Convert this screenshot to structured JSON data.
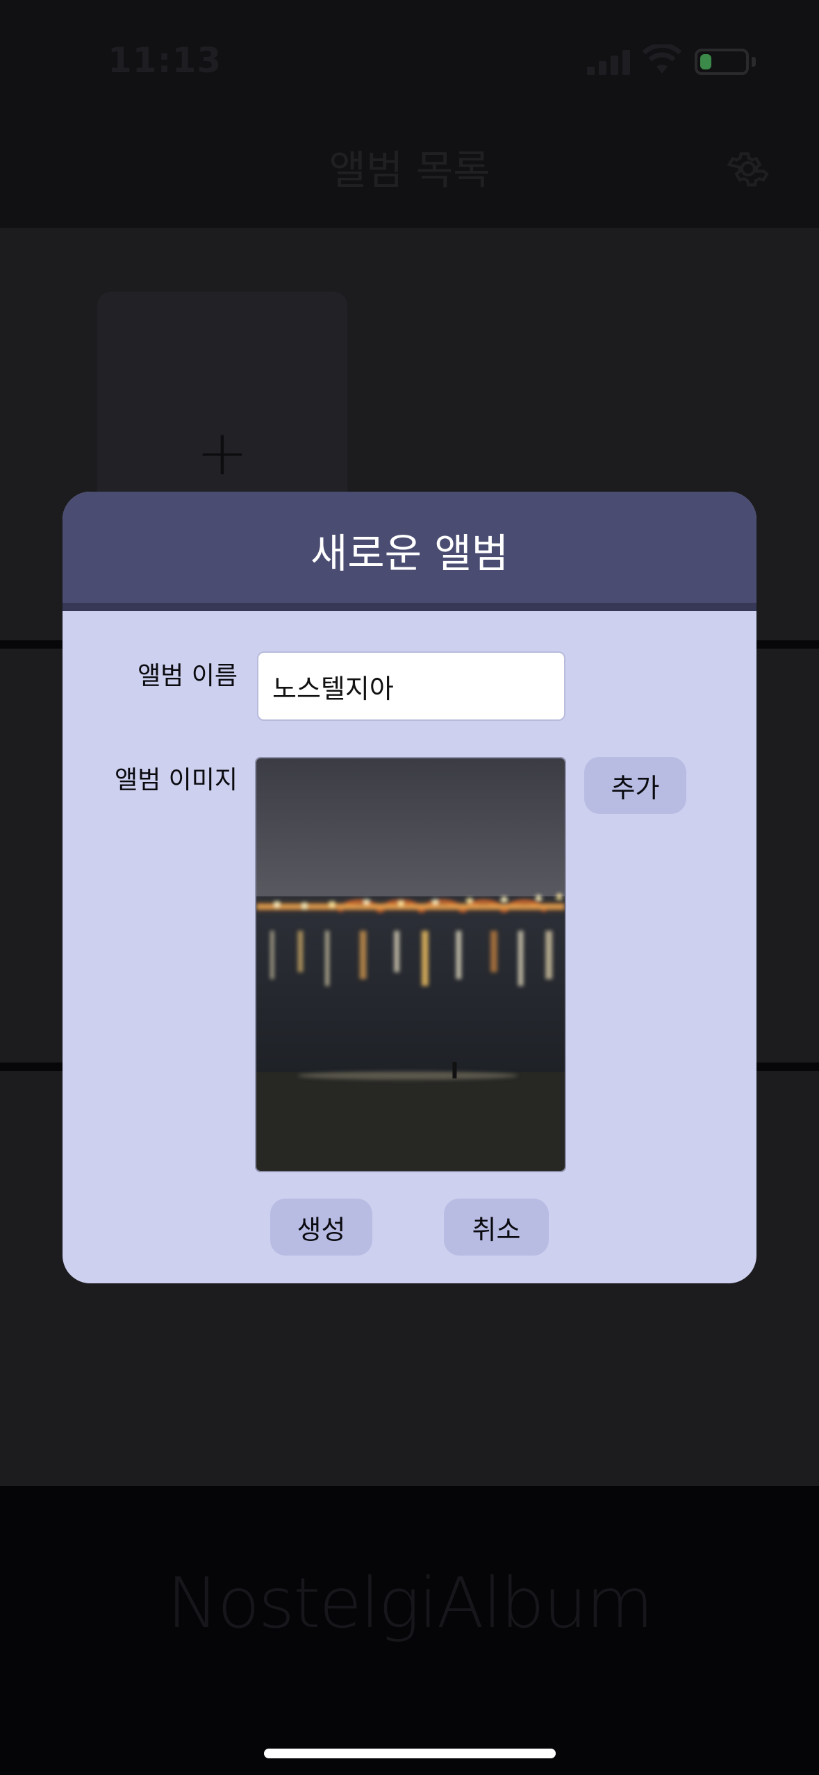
{
  "status_bar": {
    "time": "11:13"
  },
  "header": {
    "title": "앨범 목록",
    "settings_icon": "gear-icon"
  },
  "album_list": {
    "add_icon": "plus-icon",
    "add_symbol": "+"
  },
  "footer": {
    "brand": "NostelgiAlbum"
  },
  "modal": {
    "title": "새로운 앨범",
    "name_label": "앨범 이름",
    "name_value": "노스텔지아",
    "image_label": "앨범 이미지",
    "add_button": "추가",
    "create_button": "생성",
    "cancel_button": "취소"
  },
  "colors": {
    "modal_header": "#4a4c72",
    "modal_body": "#cdd0ee",
    "button": "#b8bce3",
    "overlay": "#07070c"
  }
}
